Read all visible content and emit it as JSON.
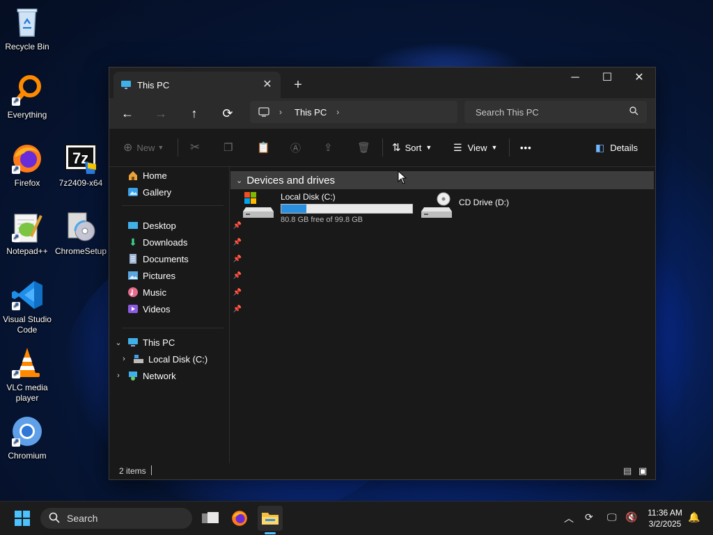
{
  "desktop": {
    "icons": [
      {
        "label": "Recycle Bin"
      },
      {
        "label": "Everything"
      },
      {
        "label": "Firefox"
      },
      {
        "label": "7z2409-x64"
      },
      {
        "label": "Notepad++"
      },
      {
        "label": "ChromeSetup"
      },
      {
        "label": "Visual Studio Code"
      },
      {
        "label": "VLC media player"
      },
      {
        "label": "Chromium"
      }
    ]
  },
  "window": {
    "tab_title": "This PC",
    "nav": {
      "breadcrumb": [
        "This PC"
      ],
      "search_placeholder": "Search This PC"
    },
    "commands": {
      "new_label": "New",
      "sort_label": "Sort",
      "view_label": "View",
      "more_label": "•••",
      "details_label": "Details"
    },
    "sidebar": {
      "top": [
        {
          "label": "Home"
        },
        {
          "label": "Gallery"
        }
      ],
      "quick": [
        {
          "label": "Desktop"
        },
        {
          "label": "Downloads"
        },
        {
          "label": "Documents"
        },
        {
          "label": "Pictures"
        },
        {
          "label": "Music"
        },
        {
          "label": "Videos"
        }
      ],
      "tree": [
        {
          "label": "This PC"
        },
        {
          "label": "Local Disk (C:)"
        },
        {
          "label": "Network"
        }
      ]
    },
    "content": {
      "group_header": "Devices and drives",
      "drives": [
        {
          "name": "Local Disk (C:)",
          "free_text": "80.8 GB free of 99.8 GB",
          "used_fraction": 0.19
        },
        {
          "name": "CD Drive (D:)"
        }
      ]
    },
    "status": {
      "item_count": "2 items"
    }
  },
  "taskbar": {
    "search_placeholder": "Search",
    "time": "11:36 AM",
    "date": "3/2/2025"
  },
  "colors": {
    "accent": "#2b8fe0",
    "window_bg": "#191919",
    "taskbar_bg": "#1c1c1c"
  }
}
